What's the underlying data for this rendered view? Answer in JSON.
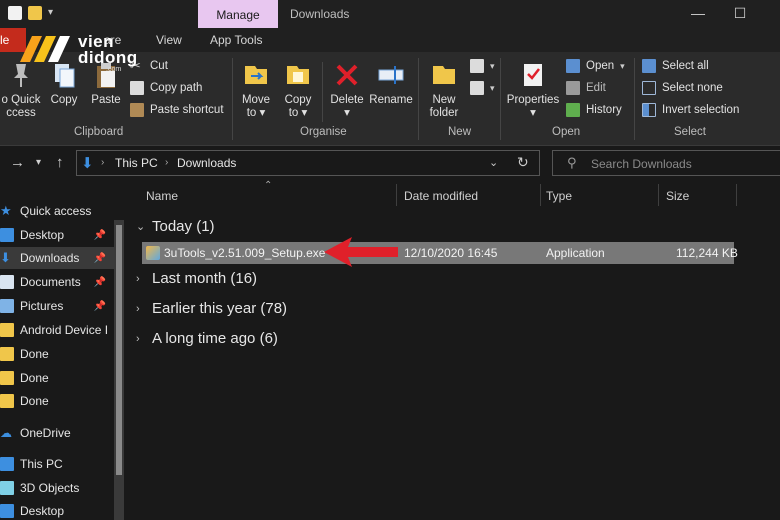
{
  "titlebar": {
    "manage_tab": "Manage",
    "window_title": "Downloads"
  },
  "ribbon_tabs": {
    "file": "le",
    "share": "are",
    "view": "View",
    "app_tools": "App Tools"
  },
  "ribbon": {
    "clipboard": {
      "pin_label": "o Quick",
      "pin_label2": "ccess",
      "copy": "Copy",
      "paste": "Paste",
      "cut": "Cut",
      "copy_path": "Copy path",
      "paste_shortcut": "Paste shortcut",
      "group": "Clipboard"
    },
    "organise": {
      "move_to": "Move",
      "move_to2": "to",
      "copy_to": "Copy",
      "copy_to2": "to",
      "delete": "Delete",
      "rename": "Rename",
      "group": "Organise"
    },
    "new": {
      "new_folder": "New",
      "new_folder2": "folder",
      "group": "New"
    },
    "open": {
      "properties": "Properties",
      "open": "Open",
      "edit": "Edit",
      "history": "History",
      "group": "Open"
    },
    "select": {
      "select_all": "Select all",
      "select_none": "Select none",
      "invert": "Invert selection",
      "group": "Select"
    }
  },
  "address": {
    "crumb1": "This PC",
    "crumb2": "Downloads",
    "search_placeholder": "Search Downloads"
  },
  "navpane": {
    "items": [
      {
        "label": "Quick access"
      },
      {
        "label": "Desktop"
      },
      {
        "label": "Downloads"
      },
      {
        "label": "Documents"
      },
      {
        "label": "Pictures"
      },
      {
        "label": "Android Device I"
      },
      {
        "label": "Done"
      },
      {
        "label": "Done"
      },
      {
        "label": "Done"
      },
      {
        "label": "OneDrive"
      },
      {
        "label": "This PC"
      },
      {
        "label": "3D Objects"
      },
      {
        "label": "Desktop"
      }
    ]
  },
  "columns": {
    "name": "Name",
    "date": "Date modified",
    "type": "Type",
    "size": "Size"
  },
  "groups": {
    "today": "Today (1)",
    "last_month": "Last month (16)",
    "earlier": "Earlier this year (78)",
    "long_ago": "A long time ago (6)"
  },
  "file": {
    "name": "3uTools_v2.51.009_Setup.exe",
    "date": "12/10/2020 16:45",
    "type": "Application",
    "size": "112,244 KB"
  },
  "logo": {
    "line1": "vien",
    "line2": "didong",
    "line3": ".com"
  },
  "colors": {
    "manage_tab": "#e8c7f0",
    "file_tab": "#c42b1c",
    "arrow": "#e0202a",
    "selection": "#787878"
  }
}
